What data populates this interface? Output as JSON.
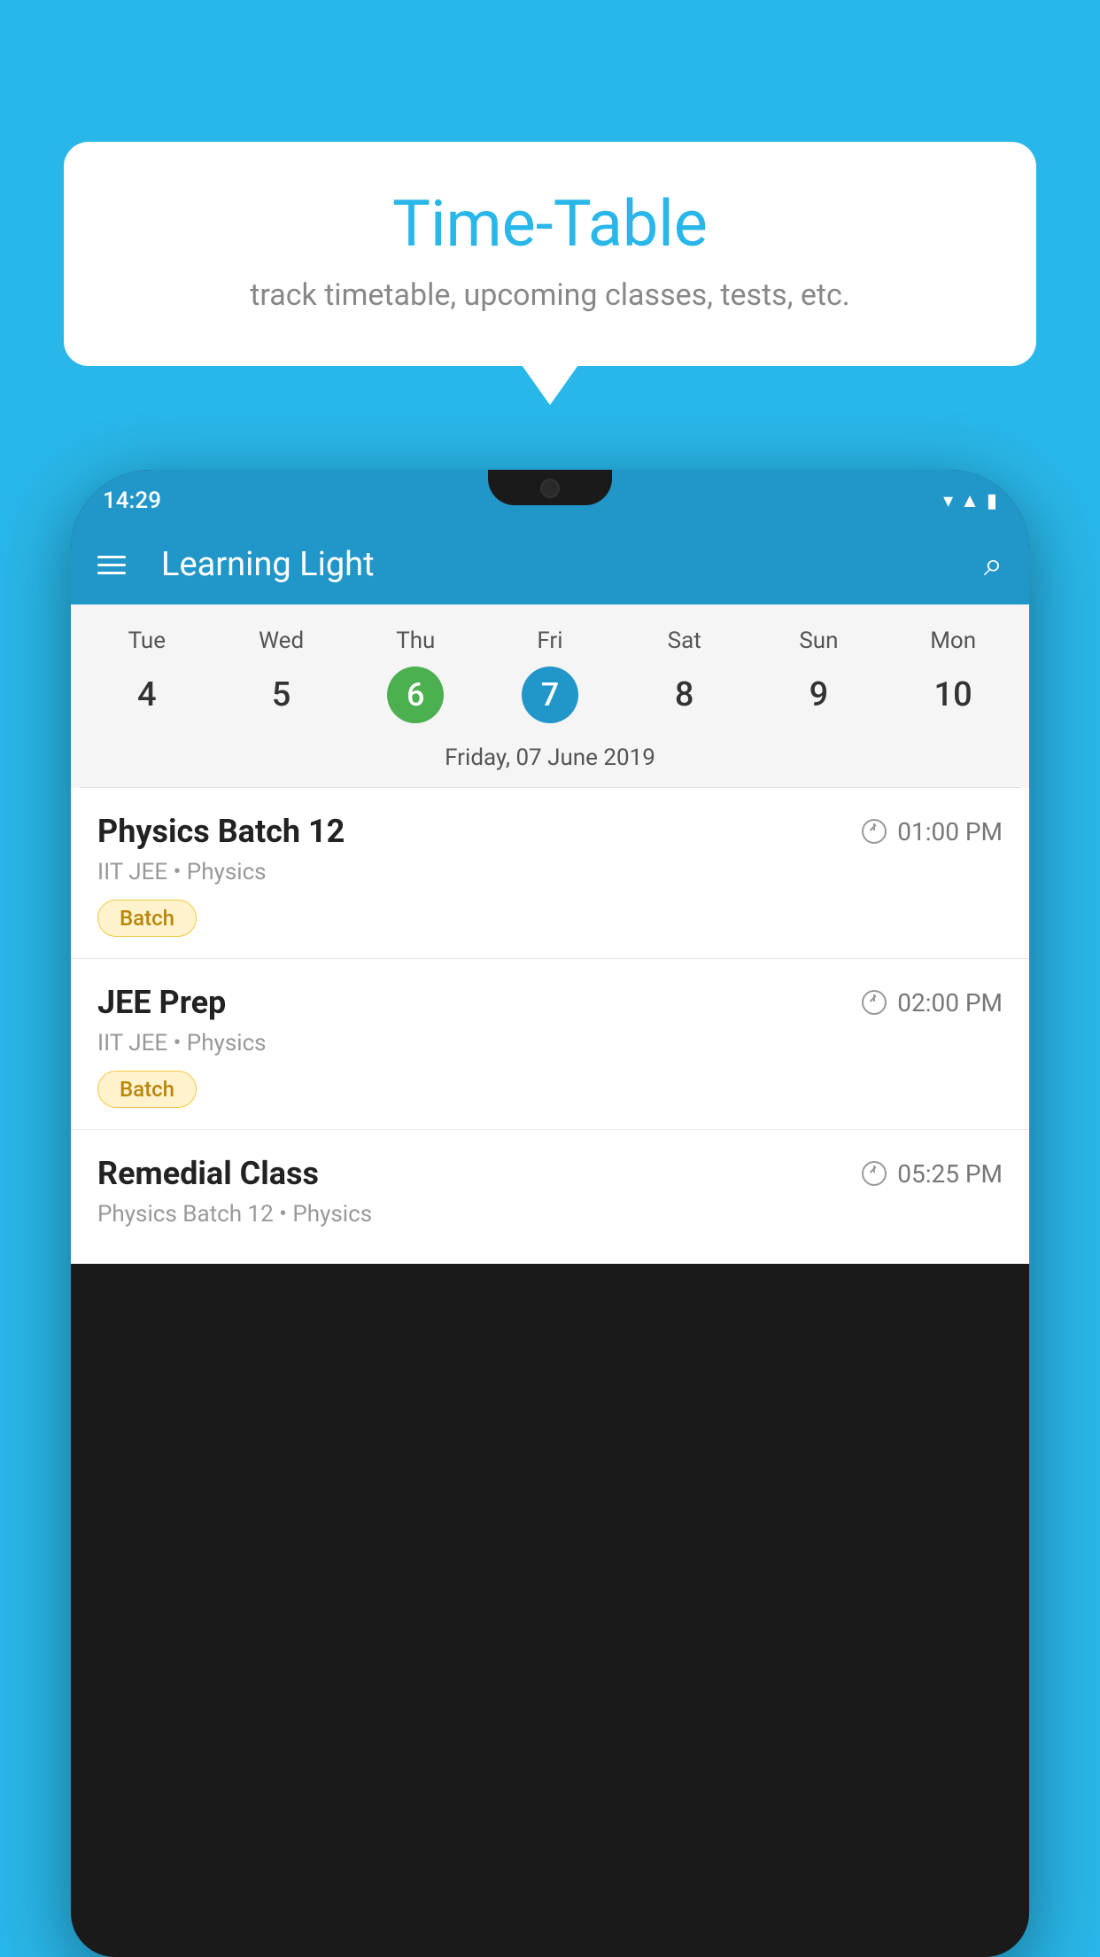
{
  "background_color": "#29B6E8",
  "tooltip": {
    "title": "Time-Table",
    "subtitle": "track timetable, upcoming classes, tests, etc."
  },
  "status_bar": {
    "time": "14:29"
  },
  "toolbar": {
    "app_name": "Learning Light"
  },
  "calendar": {
    "days": [
      {
        "name": "Tue",
        "number": "4",
        "state": "normal"
      },
      {
        "name": "Wed",
        "number": "5",
        "state": "normal"
      },
      {
        "name": "Thu",
        "number": "6",
        "state": "today"
      },
      {
        "name": "Fri",
        "number": "7",
        "state": "selected"
      },
      {
        "name": "Sat",
        "number": "8",
        "state": "normal"
      },
      {
        "name": "Sun",
        "number": "9",
        "state": "normal"
      },
      {
        "name": "Mon",
        "number": "10",
        "state": "normal"
      }
    ],
    "selected_date_label": "Friday, 07 June 2019"
  },
  "schedule": {
    "items": [
      {
        "title": "Physics Batch 12",
        "time": "01:00 PM",
        "subtitle": "IIT JEE • Physics",
        "badge": "Batch"
      },
      {
        "title": "JEE Prep",
        "time": "02:00 PM",
        "subtitle": "IIT JEE • Physics",
        "badge": "Batch"
      },
      {
        "title": "Remedial Class",
        "time": "05:25 PM",
        "subtitle": "Physics Batch 12 • Physics",
        "badge": null
      }
    ]
  }
}
